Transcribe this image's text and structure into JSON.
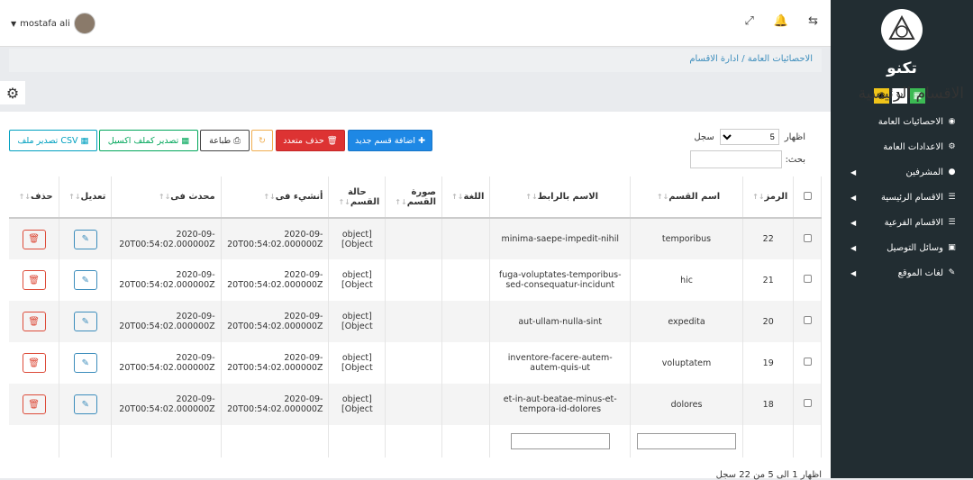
{
  "user": {
    "name": "mostafa ali"
  },
  "topbar_icons": [
    "expand-icon",
    "bell-icon",
    "exchange-icon"
  ],
  "sidebar": {
    "brand": "تكنو",
    "items": [
      {
        "label": "الاحصائيات العامة",
        "icon": "dashboard-icon",
        "caret": false
      },
      {
        "label": "الاعدادات العامة",
        "icon": "cogs-icon",
        "caret": false
      },
      {
        "label": "المشرفين",
        "icon": "users-icon",
        "caret": true
      },
      {
        "label": "الاقسام الرئيسية",
        "icon": "list-icon",
        "caret": true
      },
      {
        "label": "الاقسام الفرعية",
        "icon": "list-icon",
        "caret": true
      },
      {
        "label": "وسائل التوصيل",
        "icon": "truck-icon",
        "caret": true
      },
      {
        "label": "لغات الموقع",
        "icon": "edit-icon",
        "caret": true
      }
    ]
  },
  "breadcrumb": {
    "home": "الاحصائيات العامة",
    "sep": "/",
    "current": "ادارة الاقسام"
  },
  "page": {
    "title": "الاقسام الرئيسية"
  },
  "toolbar": {
    "add": "اضافة قسم جديد",
    "delete_multi": "حذف متعدد",
    "print": "طباعة",
    "excel": "تصدير كملف اكسيل",
    "csv": "تصدير ملف CSV"
  },
  "datatable": {
    "length_label_before": "اظهار",
    "length_value": "5",
    "length_label_after": "سجل",
    "search_label": "بحث:",
    "info": "اظهار 1 الى 5 من 22 سجل"
  },
  "table": {
    "headers": {
      "id": "الرمز",
      "name": "اسم القسم",
      "slug": "الاسم بالرابط",
      "lang": "اللغة",
      "image": "صورة القسم",
      "state": "حالة القسم",
      "created": "أنشيء فى",
      "updated": "محدث فى",
      "edit": "تعديل",
      "delete": "حذف"
    },
    "rows": [
      {
        "id": "22",
        "name": "temporibus",
        "slug": "minima-saepe-impedit-nihil",
        "state": "[object Object]",
        "created": "2020-09-20T00:54:02.000000Z",
        "updated": "2020-09-20T00:54:02.000000Z"
      },
      {
        "id": "21",
        "name": "hic",
        "slug": "fuga-voluptates-temporibus-sed-consequatur-incidunt",
        "state": "[object Object]",
        "created": "2020-09-20T00:54:02.000000Z",
        "updated": "2020-09-20T00:54:02.000000Z"
      },
      {
        "id": "20",
        "name": "expedita",
        "slug": "aut-ullam-nulla-sint",
        "state": "[object Object]",
        "created": "2020-09-20T00:54:02.000000Z",
        "updated": "2020-09-20T00:54:02.000000Z"
      },
      {
        "id": "19",
        "name": "voluptatem",
        "slug": "inventore-facere-autem-autem-quis-ut",
        "state": "[object Object]",
        "created": "2020-09-20T00:54:02.000000Z",
        "updated": "2020-09-20T00:54:02.000000Z"
      },
      {
        "id": "18",
        "name": "dolores",
        "slug": "et-in-aut-beatae-minus-et-tempora-id-dolores",
        "state": "[object Object]",
        "created": "2020-09-20T00:54:02.000000Z",
        "updated": "2020-09-20T00:54:02.000000Z"
      }
    ]
  },
  "colors": {
    "sidebar_bg": "#222d32",
    "primary": "#1e88e5",
    "danger": "#dd3333",
    "success": "#00a65a",
    "link": "#3c8dbc"
  }
}
